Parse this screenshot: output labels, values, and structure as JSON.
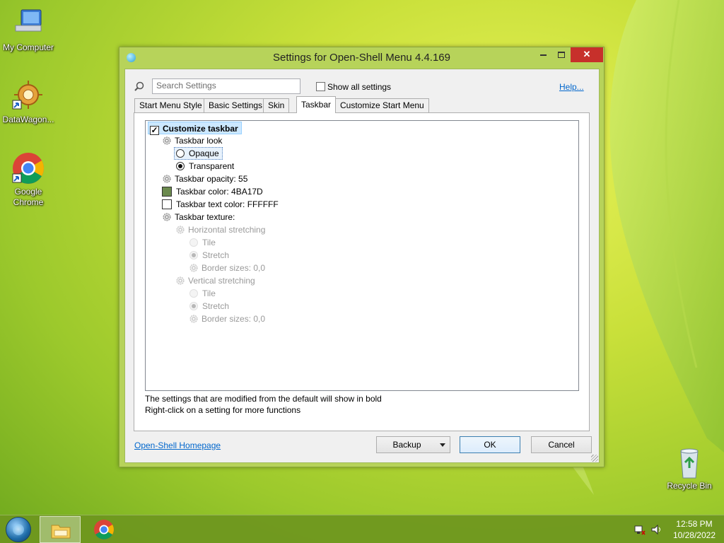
{
  "desktop": {
    "icons": [
      {
        "label": "My Computer"
      },
      {
        "label": "DataWagon..."
      },
      {
        "label": "Google Chrome"
      },
      {
        "label": "Recycle Bin"
      }
    ]
  },
  "window": {
    "title": "Settings for Open-Shell Menu 4.4.169",
    "search_placeholder": "Search Settings",
    "show_all_label": "Show all settings",
    "help_label": "Help...",
    "tabs": [
      {
        "label": "Start Menu Style"
      },
      {
        "label": "Basic Settings"
      },
      {
        "label": "Skin"
      },
      {
        "label": "Taskbar",
        "active": true
      },
      {
        "label": "Customize Start Menu"
      }
    ],
    "tree": {
      "customize_taskbar": "Customize taskbar",
      "taskbar_look": "Taskbar look",
      "opaque": "Opaque",
      "transparent": "Transparent",
      "opacity": "Taskbar opacity: 55",
      "color": "Taskbar color: 4BA17D",
      "color_hex": "#6b8a4e",
      "text_color": "Taskbar text color: FFFFFF",
      "text_color_hex": "#ffffff",
      "texture": "Taskbar texture:",
      "horizontal": "Horizontal stretching",
      "h_tile": "Tile",
      "h_stretch": "Stretch",
      "h_border": "Border sizes: 0,0",
      "vertical": "Vertical stretching",
      "v_tile": "Tile",
      "v_stretch": "Stretch",
      "v_border": "Border sizes: 0,0"
    },
    "hint1": "The settings that are modified from the default will show in bold",
    "hint2": "Right-click on a setting for more functions",
    "homepage_label": "Open-Shell Homepage",
    "backup_label": "Backup",
    "ok_label": "OK",
    "cancel_label": "Cancel"
  },
  "taskbar": {
    "time": "12:58 PM",
    "date": "10/28/2022"
  },
  "colors": {
    "accent_close": "#c7302b",
    "window_frame": "#b7d35a",
    "link": "#0066cc"
  }
}
